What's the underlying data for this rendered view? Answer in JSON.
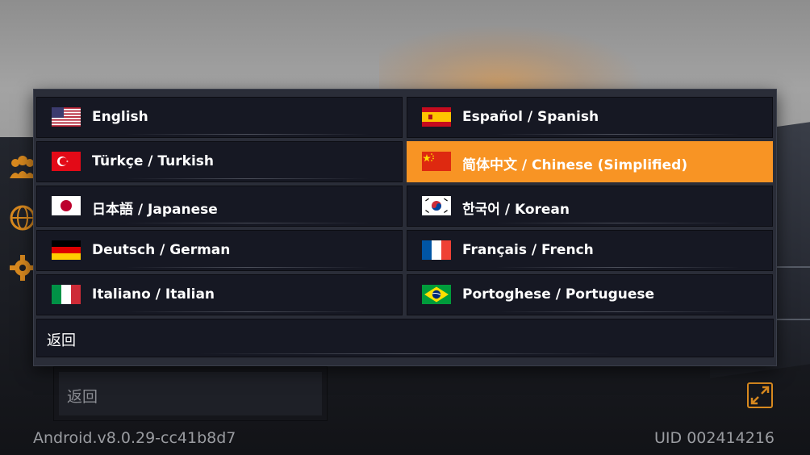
{
  "languages": [
    {
      "label": "English",
      "flag": "us-flag-icon",
      "selected": false
    },
    {
      "label": "Español / Spanish",
      "flag": "spain-flag-icon",
      "selected": false
    },
    {
      "label": "Türkçe / Turkish",
      "flag": "turkey-flag-icon",
      "selected": false
    },
    {
      "label": "简体中文 / Chinese (Simplified)",
      "flag": "china-flag-icon",
      "selected": true
    },
    {
      "label": "日本語 / Japanese",
      "flag": "japan-flag-icon",
      "selected": false
    },
    {
      "label": "한국어 / Korean",
      "flag": "korea-flag-icon",
      "selected": false
    },
    {
      "label": "Deutsch / German",
      "flag": "germany-flag-icon",
      "selected": false
    },
    {
      "label": "Français / French",
      "flag": "france-flag-icon",
      "selected": false
    },
    {
      "label": "Italiano / Italian",
      "flag": "italy-flag-icon",
      "selected": false
    },
    {
      "label": "Portoghese / Portuguese",
      "flag": "brazil-flag-icon",
      "selected": false
    }
  ],
  "dialog": {
    "back_label": "返回"
  },
  "background": {
    "back_field_label": "返回",
    "version": "Android.v8.0.29-cc41b8d7",
    "uid": "UID 002414216",
    "side_icons": [
      "people-icon",
      "globe-icon",
      "gear-icon"
    ]
  },
  "colors": {
    "accent": "#f89424",
    "button_bg": "#161823",
    "dialog_bg": "#2a2d38",
    "icon_orange": "#d8891f"
  }
}
